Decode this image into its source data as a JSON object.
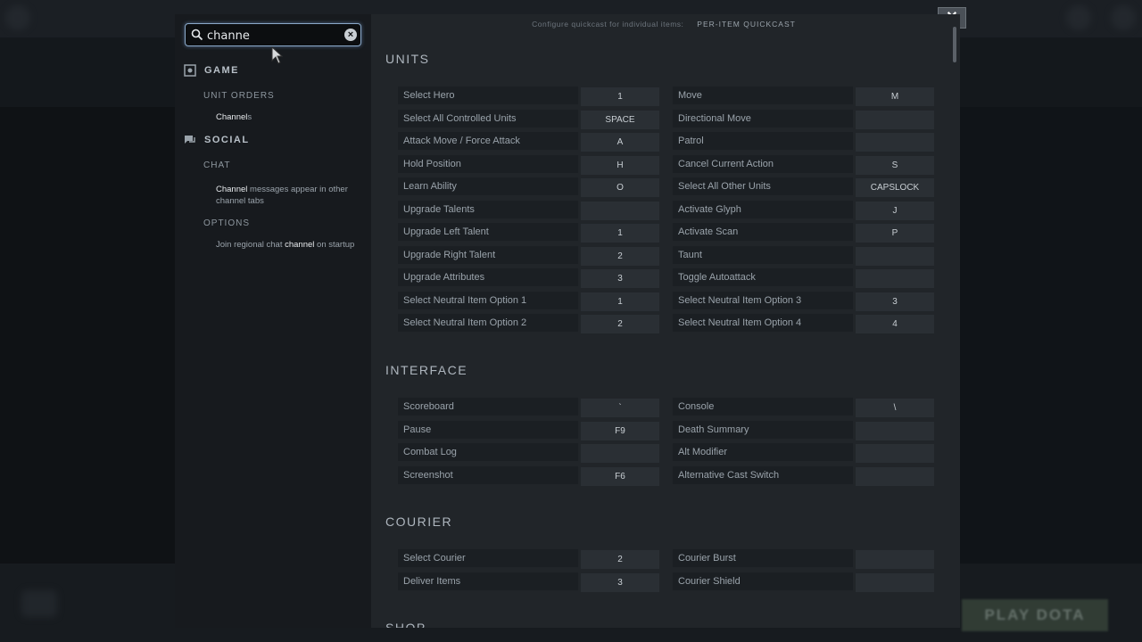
{
  "search": {
    "value": "channe"
  },
  "close_label": "✕",
  "background": {
    "play_label": "PLAY DOTA"
  },
  "sidebar": {
    "categories": [
      {
        "label": "GAME",
        "subs": [
          {
            "label": "UNIT ORDERS",
            "items": [
              {
                "match": "Channel",
                "rest": "s"
              }
            ]
          }
        ]
      },
      {
        "label": "SOCIAL",
        "subs": [
          {
            "label": "CHAT",
            "items": [
              {
                "match": "Channel",
                "rest": " messages appear in other channel tabs"
              }
            ]
          },
          {
            "label": "OPTIONS",
            "items": [
              {
                "pre": "Join regional chat ",
                "match": "channel",
                "rest": " on startup"
              }
            ]
          }
        ]
      }
    ]
  },
  "main": {
    "top_text": "Configure quickcast for individual items:",
    "top_button": "PER-ITEM QUICKCAST",
    "sections": [
      {
        "title": "UNITS",
        "left": [
          [
            "Select Hero",
            "1"
          ],
          [
            "Select All Controlled Units",
            "SPACE"
          ],
          [
            "Attack Move / Force Attack",
            "A"
          ],
          [
            "Hold Position",
            "H"
          ],
          [
            "Learn Ability",
            "O"
          ],
          [
            "Upgrade Talents",
            ""
          ],
          [
            "Upgrade Left Talent",
            "1"
          ],
          [
            "Upgrade Right Talent",
            "2"
          ],
          [
            "Upgrade Attributes",
            "3"
          ],
          [
            "Select Neutral Item Option 1",
            "1"
          ],
          [
            "Select Neutral Item Option 2",
            "2"
          ]
        ],
        "right": [
          [
            "Move",
            "M"
          ],
          [
            "Directional Move",
            ""
          ],
          [
            "Patrol",
            ""
          ],
          [
            "Cancel Current Action",
            "S"
          ],
          [
            "Select All Other Units",
            "CAPSLOCK"
          ],
          [
            "Activate Glyph",
            "J"
          ],
          [
            "Activate Scan",
            "P"
          ],
          [
            "Taunt",
            ""
          ],
          [
            "Toggle Autoattack",
            ""
          ],
          [
            "Select Neutral Item Option 3",
            "3"
          ],
          [
            "Select Neutral Item Option 4",
            "4"
          ]
        ]
      },
      {
        "title": "INTERFACE",
        "left": [
          [
            "Scoreboard",
            "`"
          ],
          [
            "Pause",
            "F9"
          ],
          [
            "Combat Log",
            ""
          ],
          [
            "Screenshot",
            "F6"
          ]
        ],
        "right": [
          [
            "Console",
            "\\"
          ],
          [
            "Death Summary",
            ""
          ],
          [
            "Alt Modifier",
            ""
          ],
          [
            "Alternative Cast Switch",
            ""
          ]
        ]
      },
      {
        "title": "COURIER",
        "left": [
          [
            "Select Courier",
            "2"
          ],
          [
            "Deliver Items",
            "3"
          ]
        ],
        "right": [
          [
            "Courier Burst",
            ""
          ],
          [
            "Courier Shield",
            ""
          ]
        ]
      },
      {
        "title": "SHOP",
        "left": [],
        "right": []
      }
    ]
  }
}
